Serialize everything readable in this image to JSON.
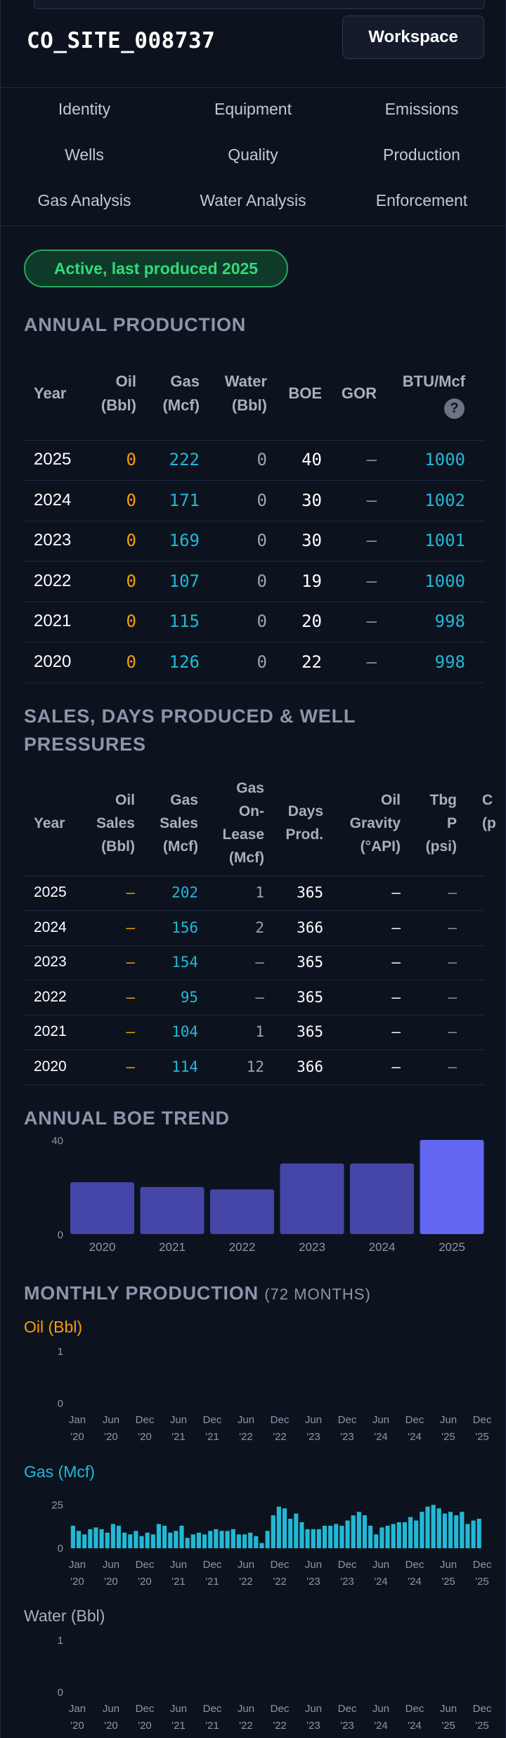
{
  "site": {
    "name": "CO_SITE_008737"
  },
  "header": {
    "workspace_label": "Workspace"
  },
  "nav": {
    "items": [
      "Identity",
      "Equipment",
      "Emissions",
      "Wells",
      "Quality",
      "Production",
      "Gas Analysis",
      "Water Analysis",
      "Enforcement"
    ]
  },
  "status": {
    "badge": "Active, last produced 2025"
  },
  "annual_production": {
    "title": "ANNUAL PRODUCTION",
    "headers": {
      "year": "Year",
      "oil": [
        "Oil",
        "(Bbl)"
      ],
      "gas": [
        "Gas",
        "(Mcf)"
      ],
      "water": [
        "Water",
        "(Bbl)"
      ],
      "boe": "BOE",
      "gor": "GOR",
      "btu": "BTU/Mcf",
      "help": "?"
    },
    "rows": [
      {
        "year": "2025",
        "oil": "0",
        "gas": "222",
        "water": "0",
        "boe": "40",
        "gor": "—",
        "btu": "1000"
      },
      {
        "year": "2024",
        "oil": "0",
        "gas": "171",
        "water": "0",
        "boe": "30",
        "gor": "—",
        "btu": "1002"
      },
      {
        "year": "2023",
        "oil": "0",
        "gas": "169",
        "water": "0",
        "boe": "30",
        "gor": "—",
        "btu": "1001"
      },
      {
        "year": "2022",
        "oil": "0",
        "gas": "107",
        "water": "0",
        "boe": "19",
        "gor": "—",
        "btu": "1000"
      },
      {
        "year": "2021",
        "oil": "0",
        "gas": "115",
        "water": "0",
        "boe": "20",
        "gor": "—",
        "btu": "998"
      },
      {
        "year": "2020",
        "oil": "0",
        "gas": "126",
        "water": "0",
        "boe": "22",
        "gor": "—",
        "btu": "998"
      }
    ]
  },
  "sales": {
    "title_line1": "SALES, DAYS PRODUCED & WELL",
    "title_line2": "PRESSURES",
    "headers": {
      "year": "Year",
      "oil_sales": [
        "Oil",
        "Sales",
        "(Bbl)"
      ],
      "gas_sales": [
        "Gas",
        "Sales",
        "(Mcf)"
      ],
      "gas_lease": [
        "Gas",
        "On-",
        "Lease",
        "(Mcf)"
      ],
      "days": [
        "Days",
        "Prod."
      ],
      "gravity": [
        "Oil",
        "Gravity",
        "(°API)"
      ],
      "tbg": [
        "Tbg",
        "P",
        "(psi)"
      ],
      "csg": [
        "C",
        "",
        "(p"
      ]
    },
    "rows": [
      {
        "year": "2025",
        "oil_sales": "—",
        "gas_sales": "202",
        "gas_lease": "1",
        "days": "365",
        "gravity": "—",
        "tbg": "—"
      },
      {
        "year": "2024",
        "oil_sales": "—",
        "gas_sales": "156",
        "gas_lease": "2",
        "days": "366",
        "gravity": "—",
        "tbg": "—"
      },
      {
        "year": "2023",
        "oil_sales": "—",
        "gas_sales": "154",
        "gas_lease": "—",
        "days": "365",
        "gravity": "—",
        "tbg": "—"
      },
      {
        "year": "2022",
        "oil_sales": "—",
        "gas_sales": "95",
        "gas_lease": "—",
        "days": "365",
        "gravity": "—",
        "tbg": "—"
      },
      {
        "year": "2021",
        "oil_sales": "—",
        "gas_sales": "104",
        "gas_lease": "1",
        "days": "365",
        "gravity": "—",
        "tbg": "—"
      },
      {
        "year": "2020",
        "oil_sales": "—",
        "gas_sales": "114",
        "gas_lease": "12",
        "days": "366",
        "gravity": "—",
        "tbg": "—"
      }
    ]
  },
  "boe_trend": {
    "title": "ANNUAL BOE TREND"
  },
  "monthly": {
    "title": "MONTHLY PRODUCTION",
    "subtitle": "(72 MONTHS)",
    "oil_label": "Oil (Bbl)",
    "gas_label": "Gas (Mcf)",
    "water_label": "Water (Bbl)"
  },
  "colors": {
    "accent": "#6366f1",
    "bar": "#4646a8",
    "oil": "#f59e0b",
    "gas": "#22b8d6",
    "water": "#9aa3b2",
    "active_green": "#34d978"
  },
  "chart_data": [
    {
      "type": "bar",
      "title": "ANNUAL BOE TREND",
      "categories": [
        "2020",
        "2021",
        "2022",
        "2023",
        "2024",
        "2025"
      ],
      "values": [
        22,
        20,
        19,
        30,
        30,
        40
      ],
      "y_ticks": [
        "40",
        "0"
      ],
      "ylim": [
        0,
        40
      ],
      "highlight": "2025"
    },
    {
      "type": "bar",
      "title": "Oil (Bbl)",
      "x": [
        "Jan '20",
        "Jun '20",
        "Dec '20",
        "Jun '21",
        "Dec '21",
        "Jun '22",
        "Dec '22",
        "Jun '23",
        "Dec '23",
        "Jun '24",
        "Dec '24",
        "Jun '25",
        "Dec '25"
      ],
      "y_ticks": [
        "1",
        "0"
      ],
      "values": [
        0,
        0,
        0,
        0,
        0,
        0,
        0,
        0,
        0,
        0,
        0,
        0,
        0,
        0,
        0,
        0,
        0,
        0,
        0,
        0,
        0,
        0,
        0,
        0,
        0,
        0,
        0,
        0,
        0,
        0,
        0,
        0,
        0,
        0,
        0,
        0,
        0,
        0,
        0,
        0,
        0,
        0,
        0,
        0,
        0,
        0,
        0,
        0,
        0,
        0,
        0,
        0,
        0,
        0,
        0,
        0,
        0,
        0,
        0,
        0,
        0,
        0,
        0,
        0,
        0,
        0,
        0,
        0,
        0,
        0,
        0,
        0
      ],
      "ylim": [
        0,
        1
      ]
    },
    {
      "type": "bar",
      "title": "Gas (Mcf)",
      "x": [
        "Jan '20",
        "Jun '20",
        "Dec '20",
        "Jun '21",
        "Dec '21",
        "Jun '22",
        "Dec '22",
        "Jun '23",
        "Dec '23",
        "Jun '24",
        "Dec '24",
        "Jun '25",
        "Dec '25"
      ],
      "y_ticks": [
        "25",
        "0"
      ],
      "values": [
        13,
        10,
        8,
        11,
        12,
        11,
        9,
        14,
        13,
        9,
        8,
        10,
        7,
        9,
        8,
        14,
        13,
        9,
        10,
        13,
        6,
        8,
        9,
        8,
        10,
        11,
        10,
        10,
        11,
        8,
        8,
        9,
        7,
        3,
        10,
        19,
        24,
        23,
        17,
        20,
        15,
        11,
        11,
        11,
        13,
        13,
        14,
        13,
        16,
        19,
        21,
        19,
        13,
        8,
        12,
        13,
        14,
        15,
        15,
        18,
        16,
        21,
        24,
        25,
        23,
        20,
        21,
        19,
        21,
        14,
        16,
        17
      ],
      "ylim": [
        0,
        30
      ]
    },
    {
      "type": "bar",
      "title": "Water (Bbl)",
      "x": [
        "Jan '20",
        "Jun '20",
        "Dec '20",
        "Jun '21",
        "Dec '21",
        "Jun '22",
        "Dec '22",
        "Jun '23",
        "Dec '23",
        "Jun '24",
        "Dec '24",
        "Jun '25",
        "Dec '25"
      ],
      "y_ticks": [
        "1",
        "0"
      ],
      "values": [
        0,
        0,
        0,
        0,
        0,
        0,
        0,
        0,
        0,
        0,
        0,
        0,
        0,
        0,
        0,
        0,
        0,
        0,
        0,
        0,
        0,
        0,
        0,
        0,
        0,
        0,
        0,
        0,
        0,
        0,
        0,
        0,
        0,
        0,
        0,
        0,
        0,
        0,
        0,
        0,
        0,
        0,
        0,
        0,
        0,
        0,
        0,
        0,
        0,
        0,
        0,
        0,
        0,
        0,
        0,
        0,
        0,
        0,
        0,
        0,
        0,
        0,
        0,
        0,
        0,
        0,
        0,
        0,
        0,
        0,
        0,
        0
      ],
      "ylim": [
        0,
        1
      ]
    }
  ]
}
